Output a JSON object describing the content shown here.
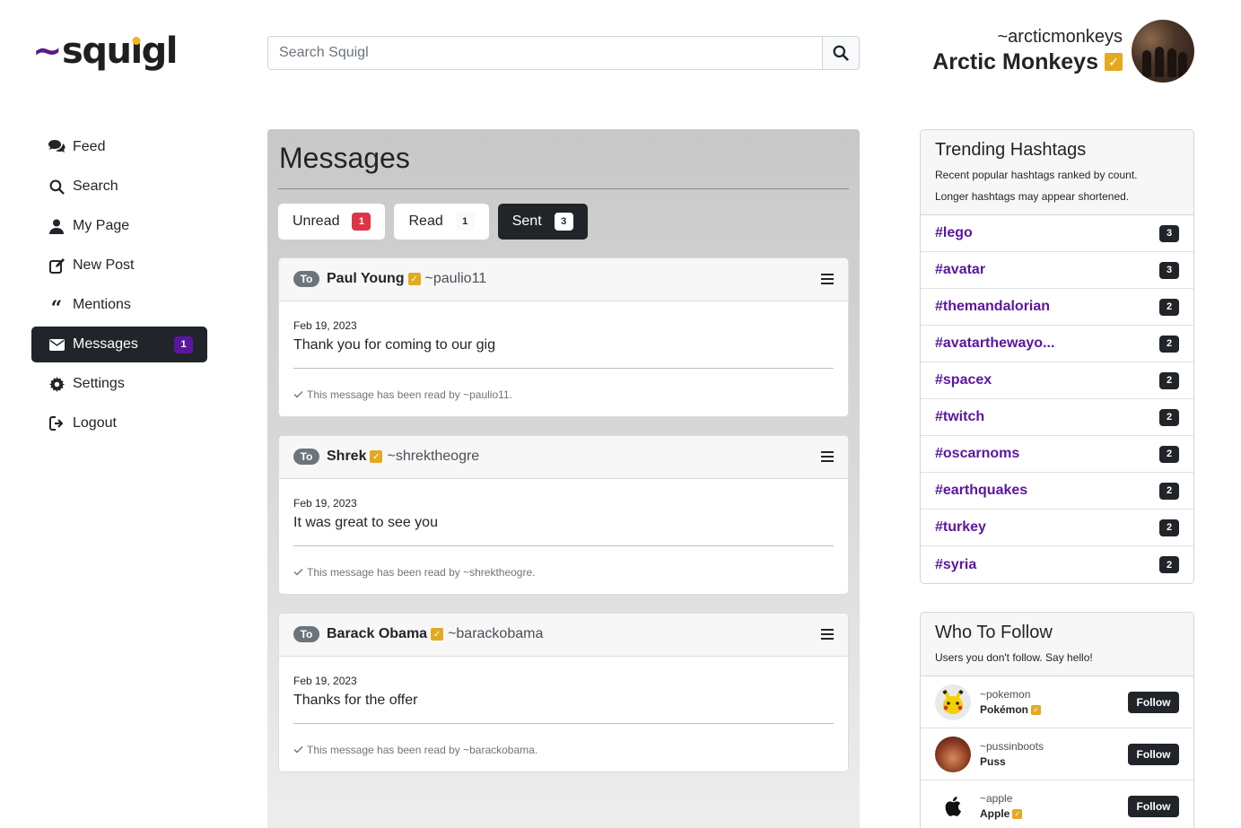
{
  "app": {
    "logo_tilde": "~",
    "logo_pre": "squ",
    "logo_i": "ı",
    "logo_post": "gl"
  },
  "search": {
    "placeholder": "Search Squigl"
  },
  "profile": {
    "handle": "~arcticmonkeys",
    "name": "Arctic Monkeys"
  },
  "nav": {
    "items": [
      {
        "label": "Feed"
      },
      {
        "label": "Search"
      },
      {
        "label": "My Page"
      },
      {
        "label": "New Post"
      },
      {
        "label": "Mentions"
      },
      {
        "label": "Messages",
        "badge": "1"
      },
      {
        "label": "Settings"
      },
      {
        "label": "Logout"
      }
    ]
  },
  "main": {
    "title": "Messages",
    "tabs": [
      {
        "label": "Unread",
        "count": "1"
      },
      {
        "label": "Read",
        "count": "1"
      },
      {
        "label": "Sent",
        "count": "3"
      }
    ],
    "to_label": "To",
    "messages": [
      {
        "name": "Paul Young",
        "handle": "~paulio11",
        "date": "Feb 19, 2023",
        "text": "Thank you for coming to our gig",
        "read_note": "This message has been read by ~paulio11."
      },
      {
        "name": "Shrek",
        "handle": "~shrektheogre",
        "date": "Feb 19, 2023",
        "text": "It was great to see you",
        "read_note": "This message has been read by ~shrektheogre."
      },
      {
        "name": "Barack Obama",
        "handle": "~barackobama",
        "date": "Feb 19, 2023",
        "text": "Thanks for the offer",
        "read_note": "This message has been read by ~barackobama."
      }
    ]
  },
  "trending": {
    "title": "Trending Hashtags",
    "subtitle_1": "Recent popular hashtags ranked by count.",
    "subtitle_2": "Longer hashtags may appear shortened.",
    "tags": [
      {
        "tag": "#lego",
        "count": "3"
      },
      {
        "tag": "#avatar",
        "count": "3"
      },
      {
        "tag": "#themandalorian",
        "count": "2"
      },
      {
        "tag": "#avatarthewayo...",
        "count": "2"
      },
      {
        "tag": "#spacex",
        "count": "2"
      },
      {
        "tag": "#twitch",
        "count": "2"
      },
      {
        "tag": "#oscarnoms",
        "count": "2"
      },
      {
        "tag": "#earthquakes",
        "count": "2"
      },
      {
        "tag": "#turkey",
        "count": "2"
      },
      {
        "tag": "#syria",
        "count": "2"
      }
    ]
  },
  "who_to_follow": {
    "title": "Who To Follow",
    "subtitle": "Users you don't follow. Say hello!",
    "button_label": "Follow",
    "users": [
      {
        "handle": "~pokemon",
        "name": "Pokémon",
        "verified": true
      },
      {
        "handle": "~pussinboots",
        "name": "Puss",
        "verified": false
      },
      {
        "handle": "~apple",
        "name": "Apple",
        "verified": true
      }
    ]
  },
  "colors": {
    "brand_purple": "#5a16a0",
    "brand_gold": "#e4a922",
    "dark": "#212529",
    "danger": "#dc3545"
  },
  "icons": {
    "feed": "chat-bubbles-icon",
    "search": "search-icon",
    "my_page": "user-icon",
    "new_post": "edit-icon",
    "mentions": "quote-icon",
    "messages": "envelope-icon",
    "settings": "gear-icon",
    "logout": "logout-icon"
  }
}
